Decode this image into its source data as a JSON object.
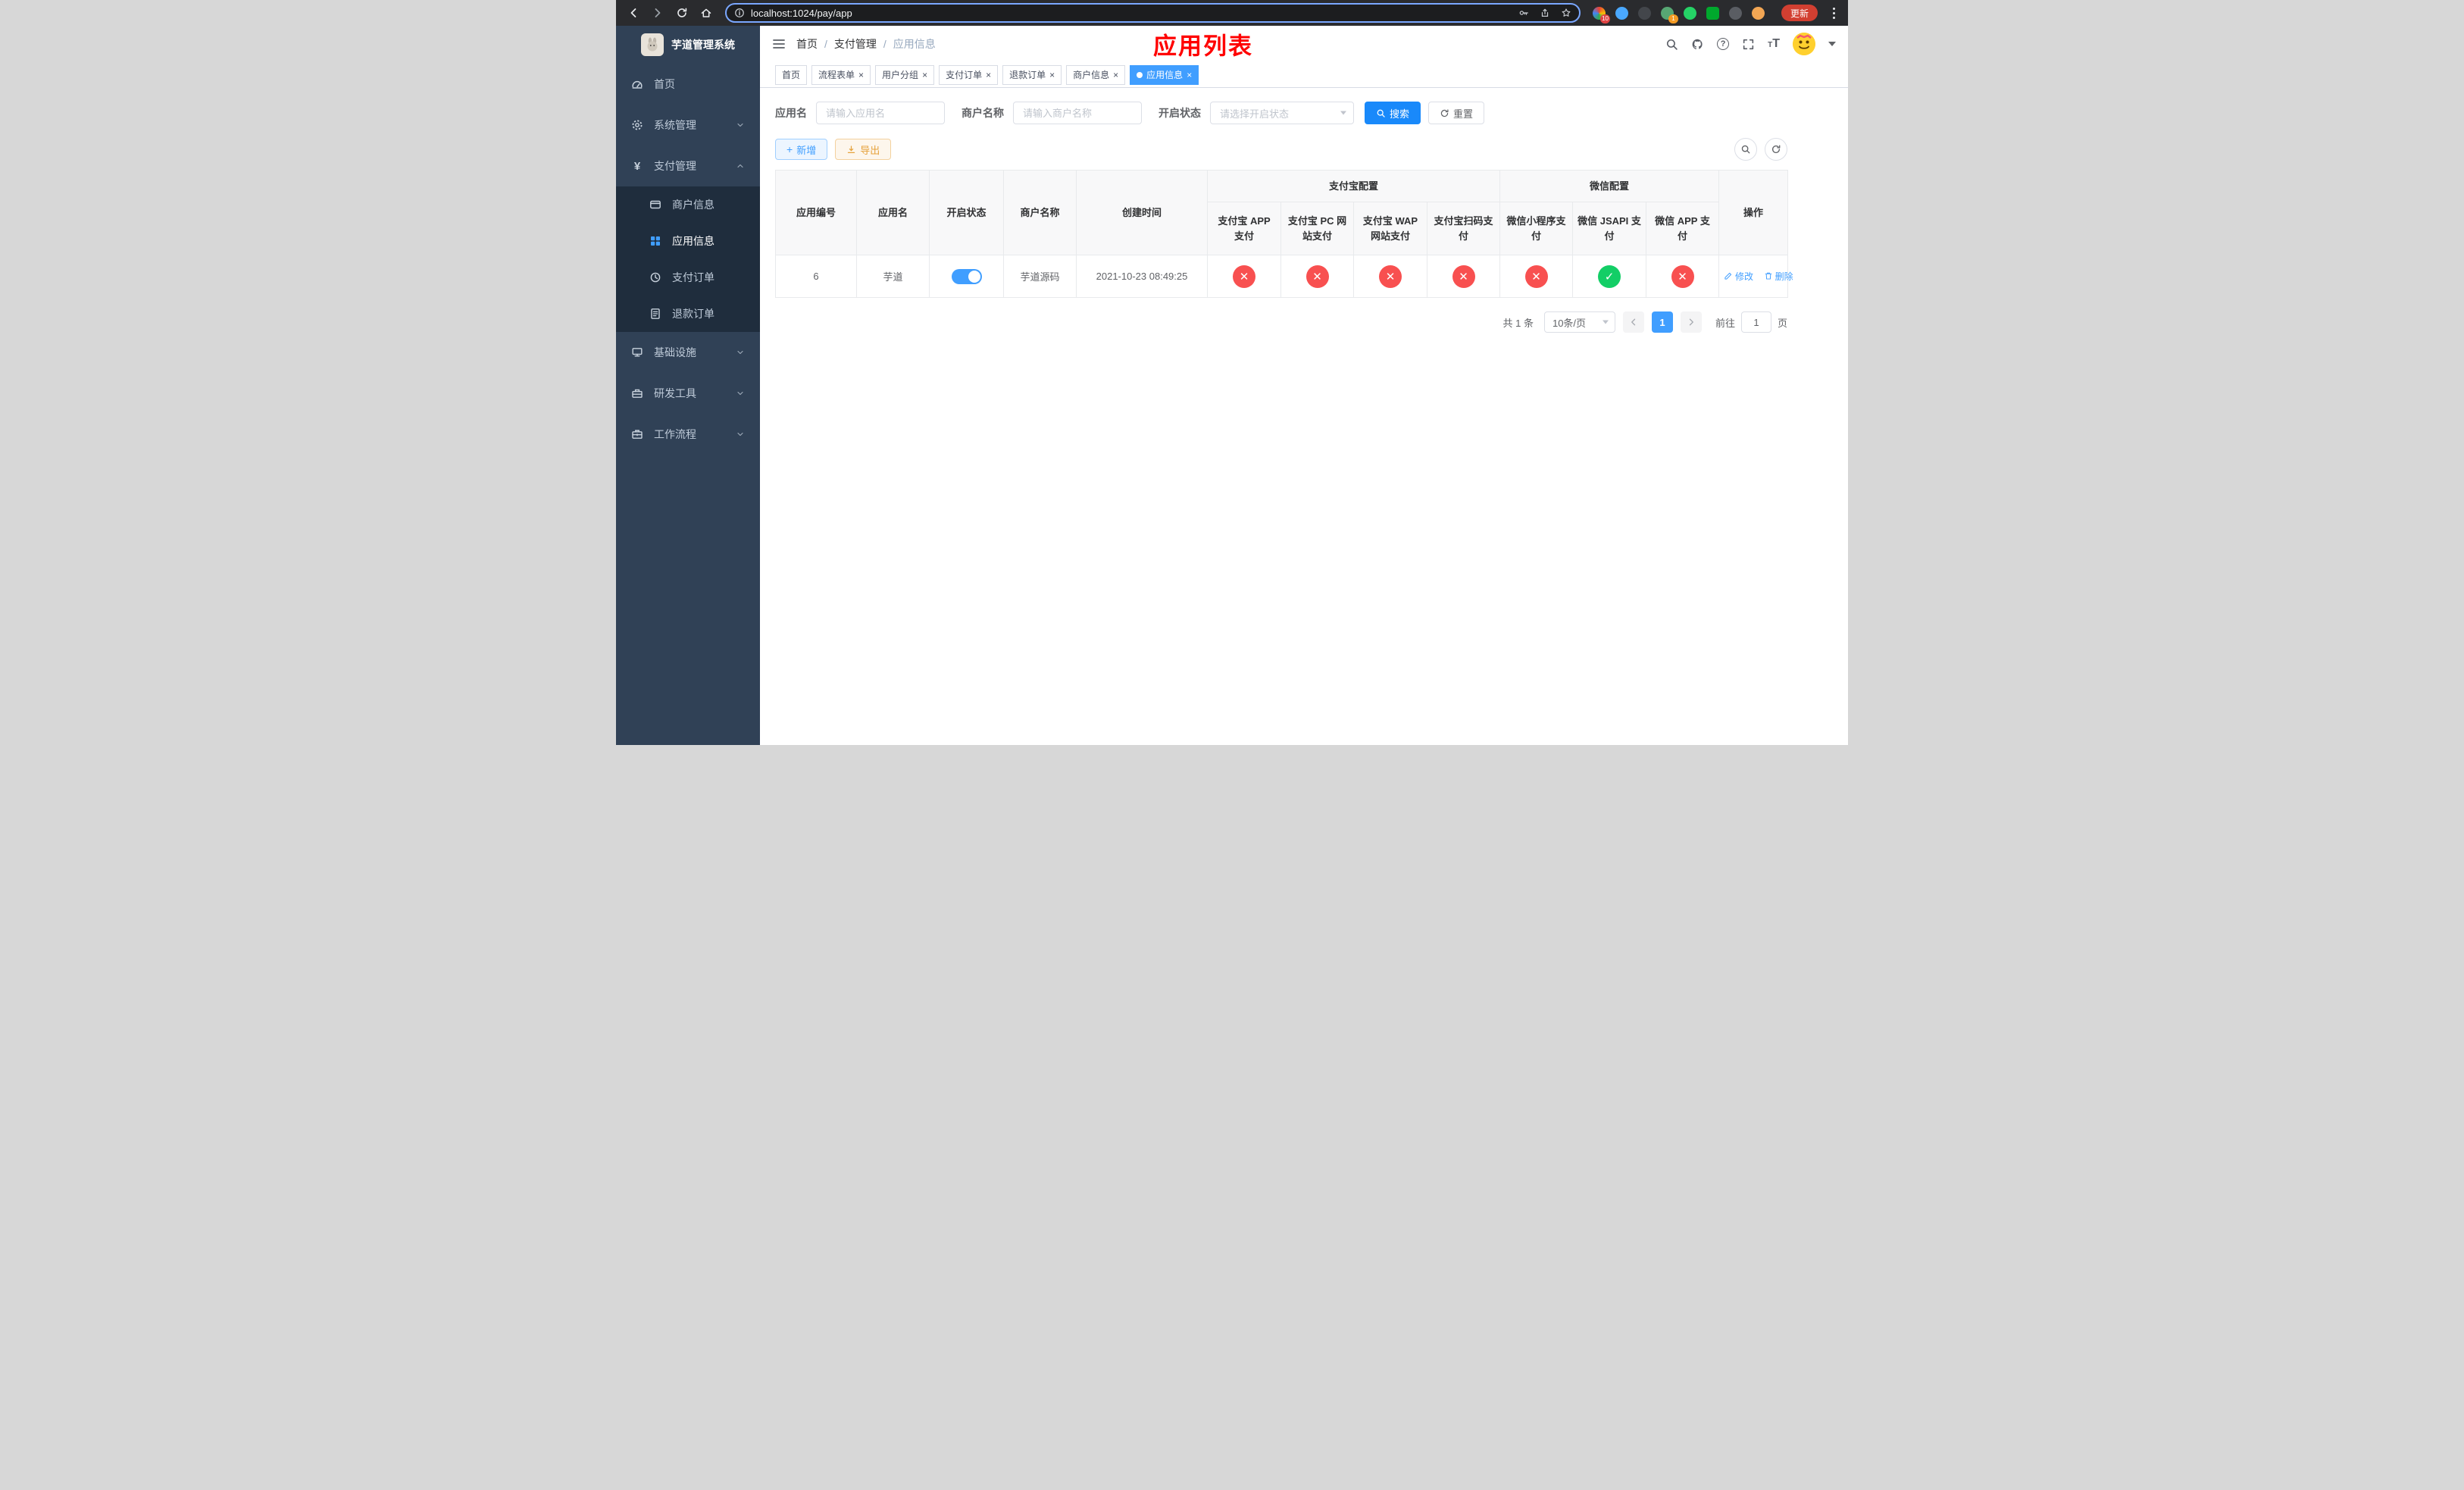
{
  "colors": {
    "accent": "#409eff",
    "primary_button": "#1989fa",
    "success": "#13ce66",
    "danger": "#f85050",
    "warning": "#e6a23c",
    "annotation_red": "#ff0000",
    "sidebar_bg": "#304156",
    "submenu_bg": "#1f2d3d",
    "tab_active_bg": "#409eff"
  },
  "icons": {
    "check_glyph": "✓",
    "cross_glyph": "✕"
  },
  "browser": {
    "url": "localhost:1024/pay/app",
    "update_button": "更新",
    "extension_badge_count": "10",
    "profile_badge_count": "1"
  },
  "sidebar": {
    "app_title": "芋道管理系统",
    "menu": [
      {
        "label": "首页",
        "icon": "dashboard-icon"
      },
      {
        "label": "系统管理",
        "icon": "gear-icon"
      },
      {
        "label": "支付管理",
        "icon": "yen-icon"
      },
      {
        "label": "基础设施",
        "icon": "infrastructure-icon"
      },
      {
        "label": "研发工具",
        "icon": "devtools-icon"
      },
      {
        "label": "工作流程",
        "icon": "workflow-icon"
      }
    ],
    "payment_submenu": [
      {
        "label": "商户信息",
        "icon": "credit-card-icon",
        "active": false
      },
      {
        "label": "应用信息",
        "icon": "grid-icon",
        "active": true
      },
      {
        "label": "支付订单",
        "icon": "clock-icon",
        "active": false
      },
      {
        "label": "退款订单",
        "icon": "document-icon",
        "active": false
      }
    ]
  },
  "header": {
    "breadcrumb": [
      "首页",
      "支付管理",
      "应用信息"
    ],
    "annotation_title": "应用列表"
  },
  "tabs": [
    {
      "label": "首页",
      "closable": false,
      "active": false
    },
    {
      "label": "流程表单",
      "closable": true,
      "active": false
    },
    {
      "label": "用户分组",
      "closable": true,
      "active": false
    },
    {
      "label": "支付订单",
      "closable": true,
      "active": false
    },
    {
      "label": "退款订单",
      "closable": true,
      "active": false
    },
    {
      "label": "商户信息",
      "closable": true,
      "active": false
    },
    {
      "label": "应用信息",
      "closable": true,
      "active": true
    }
  ],
  "filters": {
    "app_name_label": "应用名",
    "app_name_placeholder": "请输入应用名",
    "merchant_label": "商户名称",
    "merchant_placeholder": "请输入商户名称",
    "status_label": "开启状态",
    "status_placeholder": "请选择开启状态",
    "search_button": "搜索",
    "reset_button": "重置"
  },
  "toolbar": {
    "add_button": "新增",
    "export_button": "导出"
  },
  "table": {
    "group_headers": {
      "alipay": "支付宝配置",
      "wechat": "微信配置"
    },
    "columns": [
      "应用编号",
      "应用名",
      "开启状态",
      "商户名称",
      "创建时间",
      "支付宝 APP 支付",
      "支付宝 PC 网站支付",
      "支付宝 WAP 网站支付",
      "支付宝扫码支付",
      "微信小程序支付",
      "微信 JSAPI 支付",
      "微信 APP 支付",
      "操作"
    ],
    "rows": [
      {
        "id": "6",
        "name": "芋道",
        "enabled": true,
        "merchant": "芋道源码",
        "created": "2021-10-23 08:49:25",
        "channels": [
          {
            "name": "alipay-app",
            "enabled": false
          },
          {
            "name": "alipay-pc",
            "enabled": false
          },
          {
            "name": "alipay-wap",
            "enabled": false
          },
          {
            "name": "alipay-qr",
            "enabled": false
          },
          {
            "name": "wx-mini",
            "enabled": false
          },
          {
            "name": "wx-jsapi",
            "enabled": true
          },
          {
            "name": "wx-app",
            "enabled": false
          }
        ],
        "actions": {
          "edit": "修改",
          "delete": "删除"
        }
      }
    ]
  },
  "pagination": {
    "total": "共 1 条",
    "page_size": "10条/页",
    "page": "1",
    "goto_label": "前往",
    "goto_value": "1",
    "goto_unit": "页"
  }
}
